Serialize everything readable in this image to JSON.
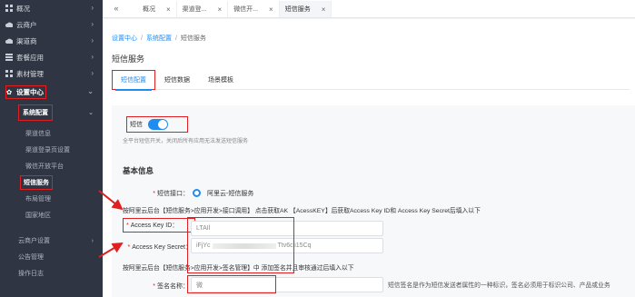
{
  "sidebar": {
    "items": [
      {
        "label": "概况",
        "icon": "grid-icon"
      },
      {
        "label": "云商户",
        "icon": "cloud-icon"
      },
      {
        "label": "渠道商",
        "icon": "cloud-icon"
      },
      {
        "label": "套餐应用",
        "icon": "list-icon"
      },
      {
        "label": "素材管理",
        "icon": "grid-icon"
      },
      {
        "label": "设置中心",
        "icon": "gear-icon"
      }
    ],
    "group_label": "系统配置",
    "sub_items": [
      "渠道信息",
      "渠道登录页设置",
      "微信开放平台",
      "短信服务",
      "布局管理",
      "国家地区"
    ],
    "bottom_items": [
      "云商户设置",
      "公告管理",
      "操作日志"
    ]
  },
  "tabbar": {
    "collapse_icon": "«",
    "tabs": [
      {
        "label": "概况"
      },
      {
        "label": "渠道登..."
      },
      {
        "label": "微信开..."
      },
      {
        "label": "短信服务"
      }
    ]
  },
  "breadcrumb": {
    "a": "设置中心",
    "b": "系统配置",
    "current": "短信服务"
  },
  "page_title": "短信服务",
  "subtabs": [
    "短信配置",
    "短信数据",
    "场景模板"
  ],
  "sms_switch": {
    "label": "短信",
    "on": true,
    "desc": "全平台短信开关，关闭后所有应用无法发送短信服务"
  },
  "basic": {
    "title": "基本信息",
    "interface_label": "短信接口：",
    "interface_option": "阿里云-短信服务",
    "hint1": "按阿里云后台【短信服务>应用开发>接口调用】 点击获取AK 【AcessKEY】后获取Access Key ID和 Access Key Secret后填入以下",
    "key_id_label": "Access Key ID：",
    "key_id_value": "LTAIl",
    "key_secret_label": "Access Key Secret：",
    "key_secret_value": "iFjYc",
    "key_secret_tail": "Ttv6cii15Cq",
    "hint2": "按阿里云后台【短信服务>应用开发>签名管理】中 添加签名并且审核通过后填入以下",
    "sign_label": "签名名称：",
    "sign_value": "微",
    "sign_note": "短信签名是作为短信发送者属性的一种标识，签名必须用于标识公司、产品或业务"
  },
  "colors": {
    "accent": "#1f8cf0",
    "sidebar": "#2f3542",
    "annotation": "#e02020"
  }
}
